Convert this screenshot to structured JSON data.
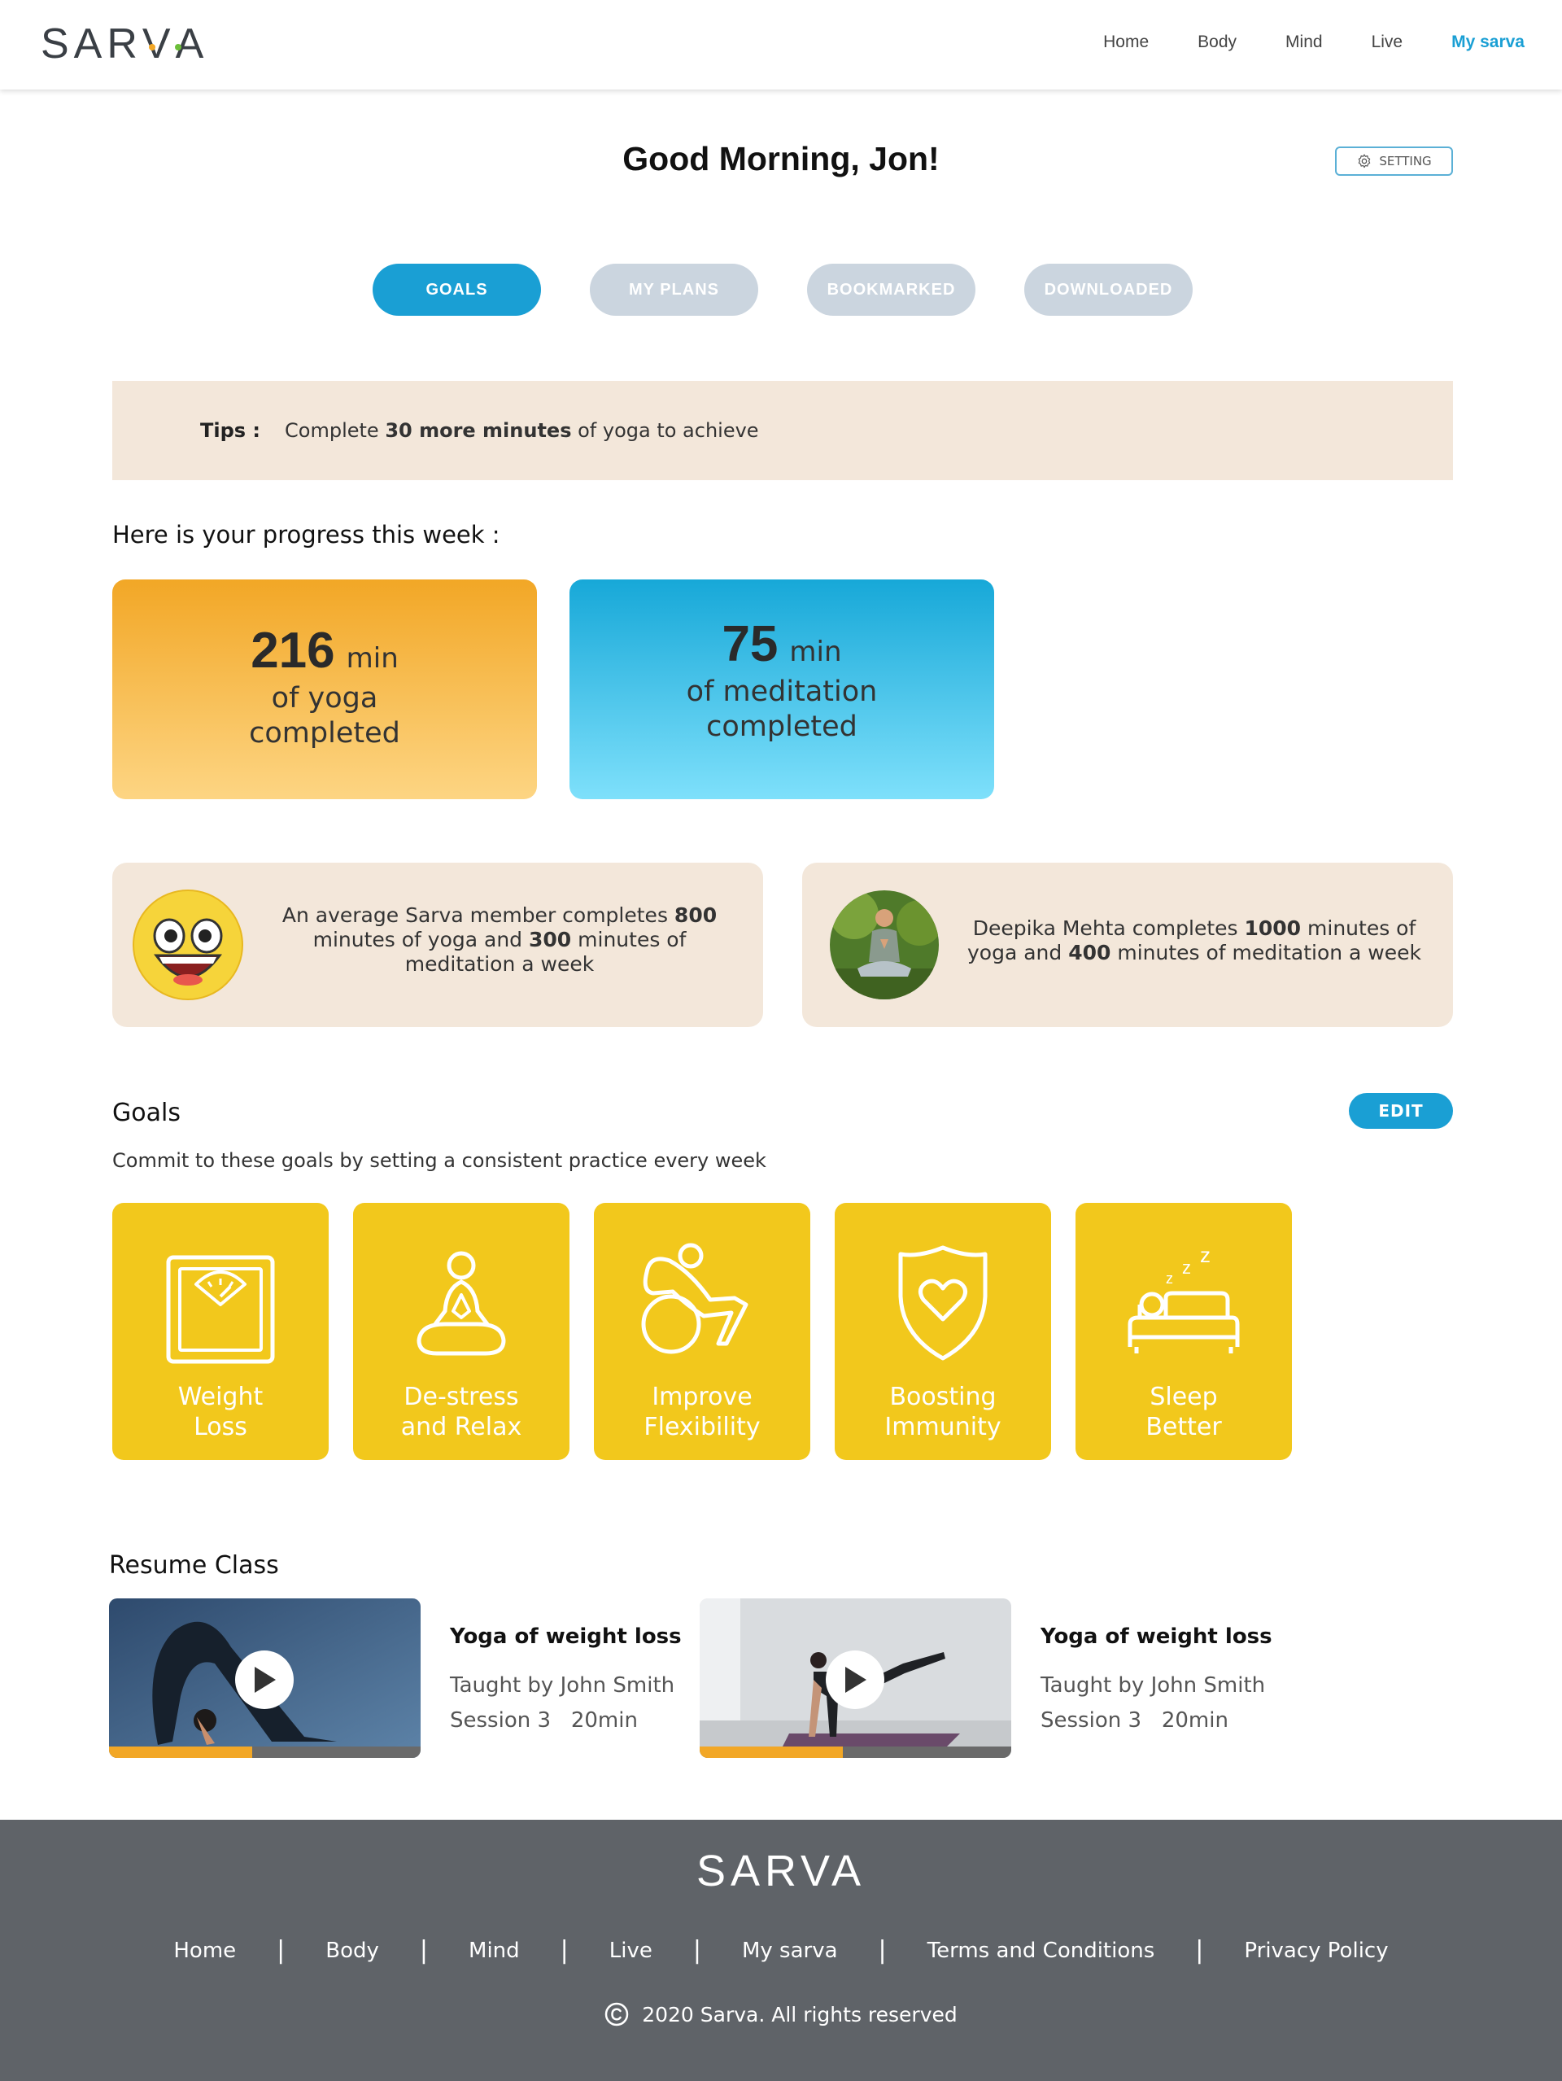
{
  "header": {
    "logo": "SARVA",
    "nav": [
      "Home",
      "Body",
      "Mind",
      "Live",
      "My sarva"
    ],
    "active_nav": "My sarva"
  },
  "greeting": "Good Morning, Jon!",
  "setting_label": "SETTING",
  "tabs": [
    {
      "label": "GOALS",
      "active": true
    },
    {
      "label": "MY PLANS",
      "active": false
    },
    {
      "label": "BOOKMARKED",
      "active": false
    },
    {
      "label": "DOWNLOADED",
      "active": false
    }
  ],
  "tips": {
    "label": "Tips :",
    "text_pre": "Complete ",
    "text_bold": "30 more minutes",
    "text_post": " of yoga to achieve"
  },
  "progress": {
    "title": "Here is your progress this week :",
    "yoga": {
      "value": "216",
      "unit": "min",
      "line1": "of yoga",
      "line2": "completed"
    },
    "meditation": {
      "value": "75",
      "unit": "min",
      "line1": "of meditation",
      "line2": "completed"
    }
  },
  "compare": {
    "average": {
      "p1": "An average Sarva member completes ",
      "b1": "800",
      "p2": " minutes of yoga and ",
      "b2": "300",
      "p3": " minutes of meditation a week"
    },
    "deepika": {
      "p1": "Deepika Mehta completes ",
      "b1": "1000",
      "p2": " minutes of yoga and ",
      "b2": "400",
      "p3": " minutes of meditation a week"
    }
  },
  "goals": {
    "title": "Goals",
    "edit_label": "EDIT",
    "subtitle": "Commit to these goals by setting a consistent practice every week",
    "items": [
      {
        "line1": "Weight",
        "line2": "Loss",
        "icon": "scale-icon"
      },
      {
        "line1": "De-stress",
        "line2": "and Relax",
        "icon": "meditation-icon"
      },
      {
        "line1": "Improve",
        "line2": "Flexibility",
        "icon": "exercise-ball-icon"
      },
      {
        "line1": "Boosting",
        "line2": "Immunity",
        "icon": "shield-heart-icon"
      },
      {
        "line1": "Sleep",
        "line2": "Better",
        "icon": "sleep-bed-icon"
      }
    ]
  },
  "resume": {
    "title": "Resume Class",
    "classes": [
      {
        "title": "Yoga of weight loss",
        "teacher": "Taught by John Smith",
        "session": "Session 3",
        "duration": "20min",
        "progress": 0.46
      },
      {
        "title": "Yoga of weight loss",
        "teacher": "Taught by John Smith",
        "session": "Session 3",
        "duration": "20min",
        "progress": 0.46
      }
    ]
  },
  "footer": {
    "logo": "SARVA",
    "links": [
      "Home",
      "Body",
      "Mind",
      "Live",
      "My sarva",
      "Terms and Conditions",
      "Privacy Policy"
    ],
    "copyright": "2020 Sarva. All rights reserved"
  },
  "colors": {
    "accent": "#1a9fd4",
    "yoga_card": "#f2a726",
    "goal_card": "#f2c81c",
    "tips_bg": "#f3e7da",
    "footer_bg": "#5f6368"
  }
}
